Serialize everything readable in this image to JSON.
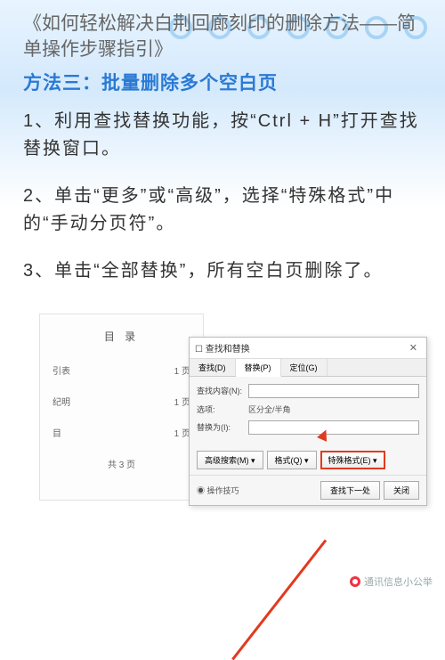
{
  "header": {
    "article_title": "《如何轻松解决白荆回廊刻印的删除方法——简单操作步骤指引》"
  },
  "method": {
    "title": "方法三：批量删除多个空白页",
    "steps": [
      "1、利用查找替换功能，按“Ctrl + H”打开查找替换窗口。",
      "2、单击“更多”或“高级”，选择“特殊格式”中的“手动分页符”。",
      "3、单击“全部替换”，所有空白页删除了。"
    ]
  },
  "doc": {
    "title": "目    录",
    "rows": [
      {
        "name": "引表",
        "page": "1 页"
      },
      {
        "name": "纪明",
        "page": "1 页"
      },
      {
        "name": "目",
        "page": "1 页"
      }
    ],
    "total": "共  3 页"
  },
  "dialog": {
    "titlebar": "查找和替换",
    "tabs": [
      "查找(D)",
      "替换(P)",
      "定位(G)"
    ],
    "find_label": "查找内容(N):",
    "find_value": "",
    "options_label": "选项:",
    "options_value": "区分全/半角",
    "replace_label": "替换为(I):",
    "replace_value": "",
    "buttons": {
      "advanced": "高级搜索(M) ▾",
      "format": "格式(Q) ▾",
      "special": "特殊格式(E) ▾"
    },
    "footer": {
      "ops": "◉ 操作技巧",
      "find_next": "查找下一处",
      "close": "关闭"
    }
  },
  "watermark": "通讯信息小公举"
}
